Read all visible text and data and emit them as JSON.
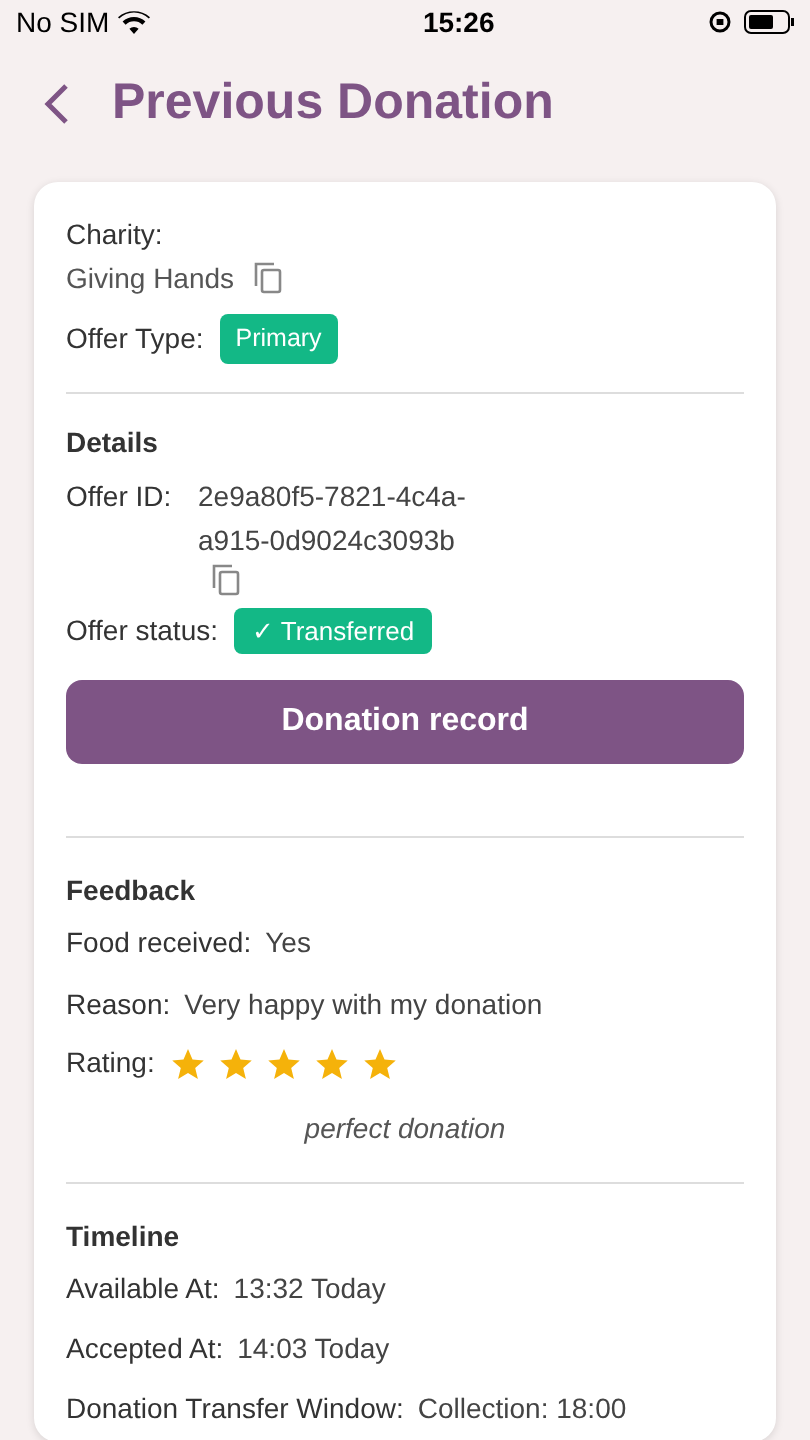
{
  "status_bar": {
    "carrier": "No SIM",
    "time": "15:26"
  },
  "header": {
    "title": "Previous Donation"
  },
  "charity": {
    "label": "Charity:",
    "name": "Giving Hands",
    "offer_type_label": "Offer Type:",
    "offer_type": "Primary"
  },
  "details": {
    "title": "Details",
    "offer_id_label": "Offer ID:",
    "offer_id_lines": [
      "2e9a80f5-7821-4c4a-",
      "a915-0d9024c3093b"
    ],
    "status_label": "Offer status:",
    "status": "Transferred",
    "status_mark": "✓"
  },
  "button": "Donation record",
  "feedback": {
    "title": "Feedback",
    "rows": [
      {
        "label": "Food received:",
        "value": "Yes"
      },
      {
        "label": "Reason:",
        "value": "Very happy with my donation"
      }
    ],
    "rating_label": "Rating:",
    "stars": 5,
    "comment": "perfect donation"
  },
  "timeline": {
    "title": "Timeline",
    "rows": [
      {
        "label": "Available At:",
        "value": "13:32 Today"
      },
      {
        "label": "Accepted At:",
        "value": "14:03 Today"
      },
      {
        "label": "Donation Transfer Window:",
        "value": "Collection: 18:00"
      }
    ]
  }
}
